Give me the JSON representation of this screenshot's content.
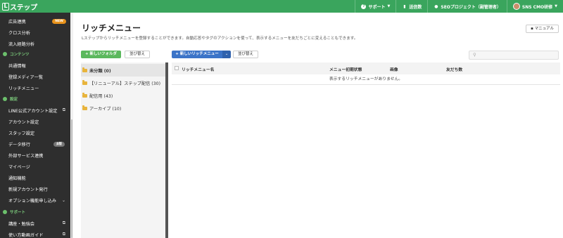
{
  "app": {
    "logo_mark": "L",
    "logo_text": "ステップ",
    "brand_color": "#3aa55d"
  },
  "topnav": {
    "support": "サポート",
    "send_count": "送信数",
    "project": "SEOプロジェクト（副管理者）",
    "user": "SNS CMO研修"
  },
  "sidebar": {
    "items": [
      {
        "label": "広告連携",
        "badge": "NEW"
      },
      {
        "label": "クロス分析"
      },
      {
        "label": "流入経路分析"
      },
      {
        "section": "コンテンツ"
      },
      {
        "label": "共通情報"
      },
      {
        "label": "登録メディア一覧"
      },
      {
        "label": "リッチメニュー"
      },
      {
        "section": "設定"
      },
      {
        "label": "LINE公式アカウント設定"
      },
      {
        "label": "アカウント設定"
      },
      {
        "label": "スタッフ設定"
      },
      {
        "label": "データ移行",
        "badge": "β版"
      },
      {
        "label": "外部サービス連携"
      },
      {
        "label": "マイページ"
      },
      {
        "label": "通知機能"
      },
      {
        "label": "新規アカウント発行"
      },
      {
        "label": "オプション機能申し込み"
      },
      {
        "section": "サポート"
      },
      {
        "label": "講座・勉強会"
      },
      {
        "label": "使い方動画ガイド"
      }
    ]
  },
  "main": {
    "title": "リッチメニュー",
    "description": "Lステップからリッチメニューを登録することができます。自動応答やタグのアクションを使って、表示するメニューを友だちごとに変えることもできます。",
    "manual_button": "マニュアル",
    "new_folder_button": "新しいフォルダ",
    "sort_button_1": "並び替え",
    "new_richmenu_button": "新しいリッチメニュー",
    "sort_button_2": "並び替え",
    "search_placeholder": ""
  },
  "folders": [
    {
      "label": "未分類 (0)",
      "active": true
    },
    {
      "label": "【リニューアル】ステップ配信 (30)"
    },
    {
      "label": "配信用 (43)"
    },
    {
      "label": "アーカイブ (10)"
    }
  ],
  "table": {
    "columns": [
      "リッチメニュー名",
      "メニュー初期状態",
      "画像",
      "友だち数"
    ],
    "empty_message": "表示するリッチメニューがありません。"
  }
}
